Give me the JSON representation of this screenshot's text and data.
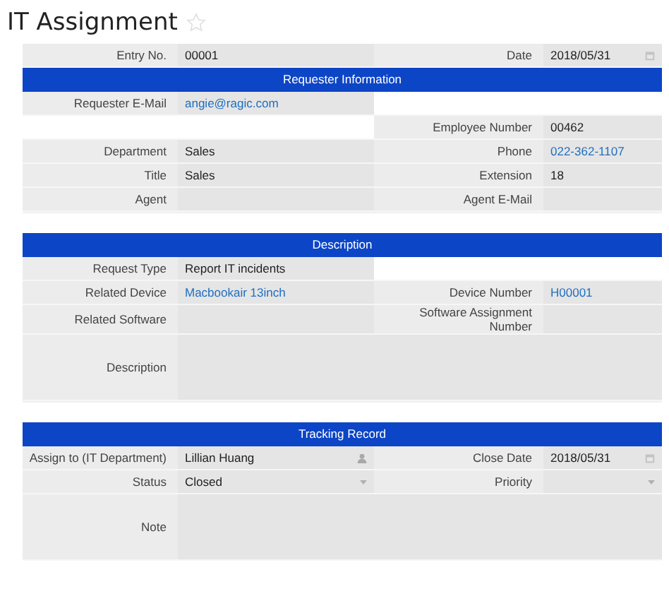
{
  "title": "IT Assignment",
  "favorite": false,
  "sections": [
    {
      "rows": [
        {
          "left": {
            "label": "Entry No.",
            "kind": "text",
            "value": "00001"
          },
          "right": {
            "label": "Date",
            "kind": "date",
            "value": "2018/05/31"
          }
        }
      ]
    },
    {
      "title": "Requester Information",
      "rows": [
        {
          "left": {
            "label": "Requester E-Mail",
            "kind": "link",
            "value": "angie@ragic.com"
          }
        },
        {
          "right": {
            "label": "Employee Number",
            "kind": "text",
            "value": "00462"
          }
        },
        {
          "left": {
            "label": "Department",
            "kind": "text",
            "value": "Sales"
          },
          "right": {
            "label": "Phone",
            "kind": "link",
            "value": "022-362-1107"
          }
        },
        {
          "left": {
            "label": "Title",
            "kind": "text",
            "value": "Sales"
          },
          "right": {
            "label": "Extension",
            "kind": "text",
            "value": "18"
          }
        },
        {
          "left": {
            "label": "Agent",
            "kind": "text"
          },
          "right": {
            "label": "Agent E-Mail",
            "kind": "text"
          }
        }
      ]
    },
    {
      "title": "Description",
      "rows": [
        {
          "left": {
            "label": "Request Type",
            "kind": "text",
            "value": "Report IT incidents"
          }
        },
        {
          "left": {
            "label": "Related Device",
            "kind": "link",
            "value": "Macbookair 13inch"
          },
          "right": {
            "label": "Device Number",
            "kind": "link",
            "value": "H00001"
          }
        },
        {
          "left": {
            "label": "Related Software",
            "kind": "text"
          },
          "right": {
            "label": "Software Assignment Number",
            "kind": "text"
          }
        },
        {
          "wide": {
            "label": "Description",
            "kind": "textarea"
          }
        }
      ]
    },
    {
      "title": "Tracking Record",
      "rows": [
        {
          "left": {
            "label": "Assign to (IT Department)",
            "kind": "user",
            "value": "Lillian Huang"
          },
          "right": {
            "label": "Close Date",
            "kind": "date",
            "value": "2018/05/31"
          }
        },
        {
          "left": {
            "label": "Status",
            "kind": "select",
            "value": "Closed"
          },
          "right": {
            "label": "Priority",
            "kind": "select"
          }
        },
        {
          "wide": {
            "label": "Note",
            "kind": "textarea"
          }
        }
      ]
    }
  ]
}
